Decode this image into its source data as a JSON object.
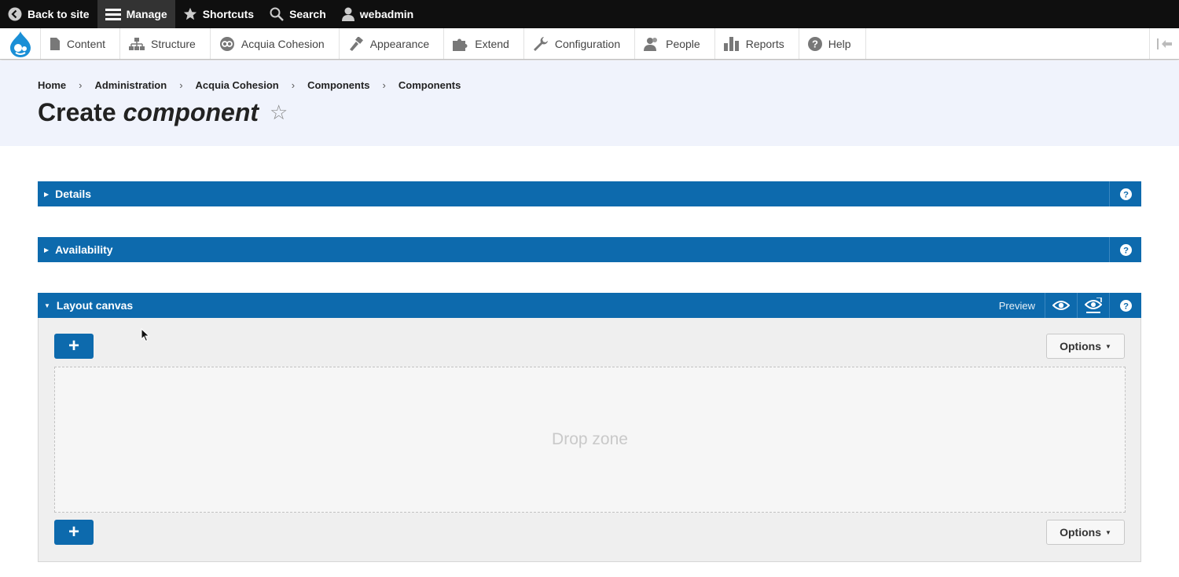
{
  "toolbar": {
    "back_label": "Back to site",
    "manage_label": "Manage",
    "shortcuts_label": "Shortcuts",
    "search_label": "Search",
    "user_label": "webadmin"
  },
  "tray": {
    "items": [
      {
        "label": "Content",
        "icon": "document-icon"
      },
      {
        "label": "Structure",
        "icon": "sitemap-icon"
      },
      {
        "label": "Acquia Cohesion",
        "icon": "cohesion-icon"
      },
      {
        "label": "Appearance",
        "icon": "paint-icon"
      },
      {
        "label": "Extend",
        "icon": "puzzle-icon"
      },
      {
        "label": "Configuration",
        "icon": "wrench-icon"
      },
      {
        "label": "People",
        "icon": "people-icon"
      },
      {
        "label": "Reports",
        "icon": "bar-chart-icon"
      },
      {
        "label": "Help",
        "icon": "question-icon"
      }
    ]
  },
  "breadcrumb": [
    "Home",
    "Administration",
    "Acquia Cohesion",
    "Components",
    "Components"
  ],
  "page": {
    "title_plain": "Create",
    "title_em": "component",
    "star": "☆"
  },
  "sections": {
    "details": "Details",
    "availability": "Availability",
    "layout": "Layout canvas",
    "preview": "Preview"
  },
  "canvas": {
    "add_symbol": "+",
    "options_label": "Options",
    "dropzone_label": "Drop zone"
  },
  "colors": {
    "accent": "#0d6aad",
    "toolbar_bg": "#0f0f0f",
    "header_bg": "#f0f3fc"
  }
}
